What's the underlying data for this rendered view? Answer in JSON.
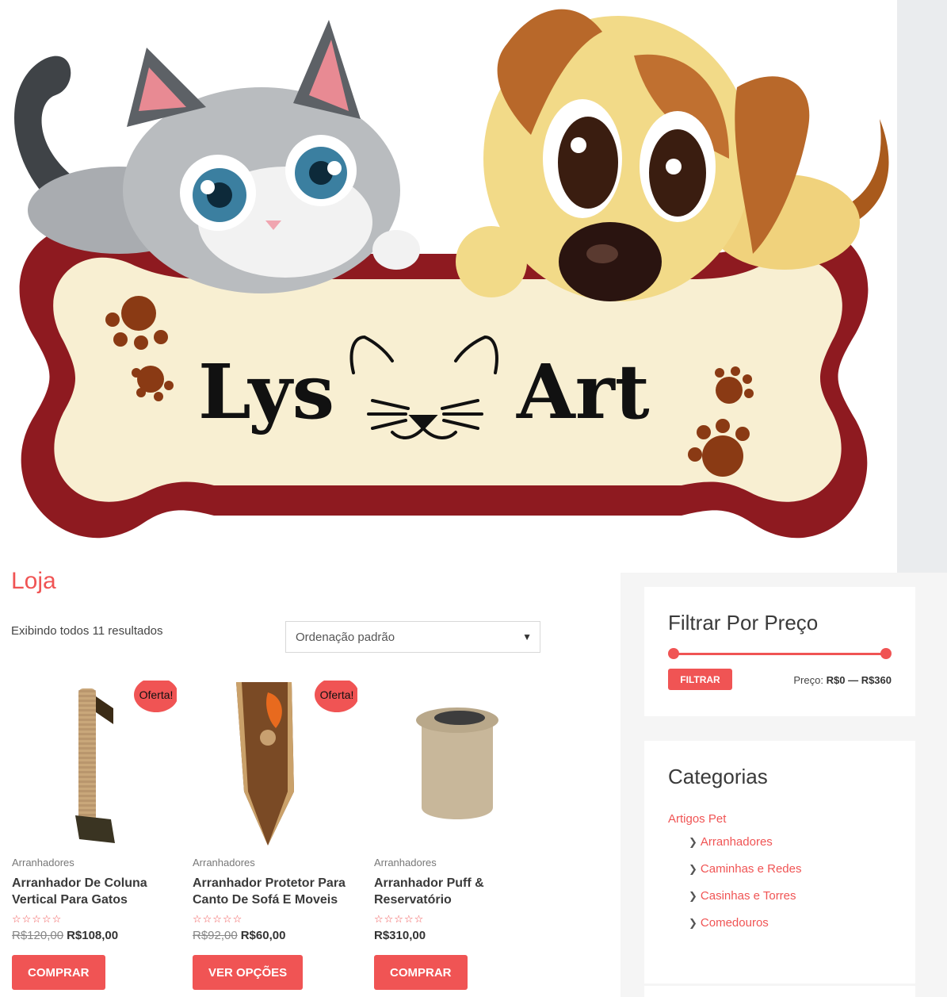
{
  "header": {
    "logo_text_left": "Lys",
    "logo_text_right": "Art"
  },
  "main": {
    "title": "Loja",
    "result_count": "Exibindo todos 11 resultados",
    "sort": {
      "selected": "Ordenação padrão"
    }
  },
  "products": [
    {
      "category": "Arranhadores",
      "title": "Arranhador De Coluna Vertical Para Gatos",
      "sale_badge": "Oferta!",
      "old_price": "R$120,00",
      "price": "R$108,00",
      "button": "COMPRAR",
      "rating": 0
    },
    {
      "category": "Arranhadores",
      "title": "Arranhador Protetor Para Canto De Sofá E Moveis",
      "sale_badge": "Oferta!",
      "old_price": "R$92,00",
      "price": "R$60,00",
      "button": "VER OPÇÕES",
      "rating": 0
    },
    {
      "category": "Arranhadores",
      "title": "Arranhador Puff & Reservatório",
      "sale_badge": "",
      "old_price": "",
      "price": "R$310,00",
      "button": "COMPRAR",
      "rating": 0
    }
  ],
  "sidebar": {
    "price_filter": {
      "title": "Filtrar Por Preço",
      "button": "FILTRAR",
      "label": "Preço:",
      "min": "R$0",
      "separator": "—",
      "max": "R$360"
    },
    "categories": {
      "title": "Categorias",
      "parent": "Artigos Pet",
      "items": [
        "Arranhadores",
        "Caminhas e Redes",
        "Casinhas e Torres",
        "Comedouros"
      ]
    }
  },
  "colors": {
    "accent": "#f05454",
    "sidebar_bg": "#f5f5f5",
    "strip": "#eaecee"
  },
  "icons": [
    "chevron-down-icon",
    "star-outline-icon",
    "chevron-right-icon",
    "paw-icon",
    "cat-face-icon"
  ]
}
